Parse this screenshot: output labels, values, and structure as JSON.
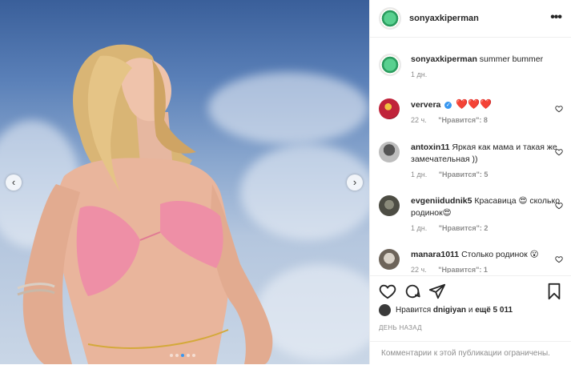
{
  "post": {
    "username": "sonyaxkiperman",
    "more_icon": "more-horizontal-icon",
    "caption": "summer bummer",
    "caption_time": "1 дн.",
    "carousel": {
      "slides": 5,
      "active": 2
    }
  },
  "comments": [
    {
      "username": "ververa",
      "verified": true,
      "text": "",
      "emoji": "❤️❤️❤️",
      "time": "22 ч.",
      "likes": "\"Нравится\": 8"
    },
    {
      "username": "antoxin11",
      "text": "Яркая как мама и такая же замечательная ))",
      "time": "1 дн.",
      "likes": "\"Нравится\": 5"
    },
    {
      "username": "evgeniidudnik5",
      "text": "Красавица 😍 сколько родинок😍",
      "time": "1 дн.",
      "likes": "\"Нравится\": 2"
    },
    {
      "username": "manara1011",
      "text": "Столько родинок 😮",
      "time": "22 ч.",
      "likes": "\"Нравится\": 1"
    }
  ],
  "actions": {
    "like_icon": "heart-icon",
    "comment_icon": "comment-icon",
    "share_icon": "send-icon",
    "save_icon": "bookmark-icon"
  },
  "likes_summary": {
    "prefix": "Нравится",
    "user": "dnigiyan",
    "and": "и",
    "others": "ещё 5 011"
  },
  "posted_ago": "ДЕНЬ НАЗАД",
  "comments_limited": "Комментарии к этой публикации ограничены."
}
